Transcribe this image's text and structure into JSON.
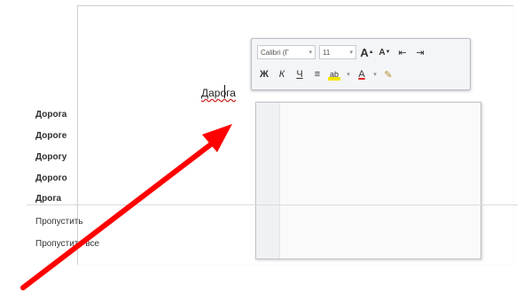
{
  "document": {
    "misspelled_word": "Дарога"
  },
  "mini_toolbar": {
    "font_name": "Calibri (Г",
    "font_size": "11",
    "grow_font": "A",
    "shrink_font": "A",
    "bold": "Ж",
    "italic": "К",
    "underline": "Ч",
    "highlight_glyph": "ab",
    "font_color_glyph": "A",
    "highlight_color": "#f3e600",
    "font_color": "#e02020"
  },
  "context_menu": {
    "suggestions": [
      "Дорога",
      "Дороге",
      "Дорогу",
      "Дорого",
      "Дрога"
    ],
    "actions": [
      "Пропустить",
      "Пропустить все"
    ]
  },
  "annotation": {
    "arrow_color": "#ff0000"
  }
}
